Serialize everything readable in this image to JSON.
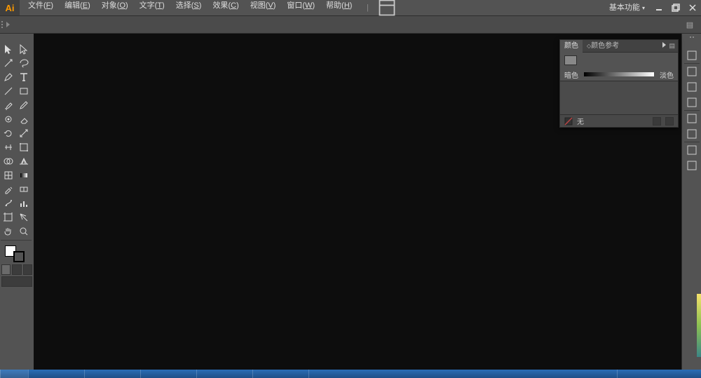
{
  "app_icon_text": "Ai",
  "menu": {
    "file": {
      "label": "文件",
      "key": "F"
    },
    "edit": {
      "label": "编辑",
      "key": "E"
    },
    "object": {
      "label": "对象",
      "key": "O"
    },
    "type": {
      "label": "文字",
      "key": "T"
    },
    "select": {
      "label": "选择",
      "key": "S"
    },
    "effect": {
      "label": "效果",
      "key": "C"
    },
    "view": {
      "label": "视图",
      "key": "V"
    },
    "window": {
      "label": "窗口",
      "key": "W"
    },
    "help": {
      "label": "帮助",
      "key": "H"
    }
  },
  "workspace_label": "基本功能",
  "panel": {
    "tab_color": "颜色",
    "tab_guide": "颜色参考",
    "dark_label": "暗色",
    "light_label": "淡色",
    "none_label": "无"
  },
  "tool_names": [
    "selection",
    "direct-selection",
    "magic-wand",
    "lasso",
    "pen",
    "type",
    "line-segment",
    "rectangle",
    "paintbrush",
    "pencil",
    "blob-brush",
    "eraser",
    "rotate",
    "scale",
    "width",
    "free-transform",
    "shape-builder",
    "perspective-grid",
    "mesh",
    "gradient",
    "eyedropper",
    "blend",
    "symbol-sprayer",
    "column-graph",
    "artboard",
    "slice",
    "hand",
    "zoom"
  ],
  "dock_icons": [
    "color-panel",
    "swatches-panel",
    "brush-panel",
    "symbols-panel",
    "stroke-panel",
    "graphic-styles-panel",
    "appearance-panel",
    "layers-panel"
  ]
}
